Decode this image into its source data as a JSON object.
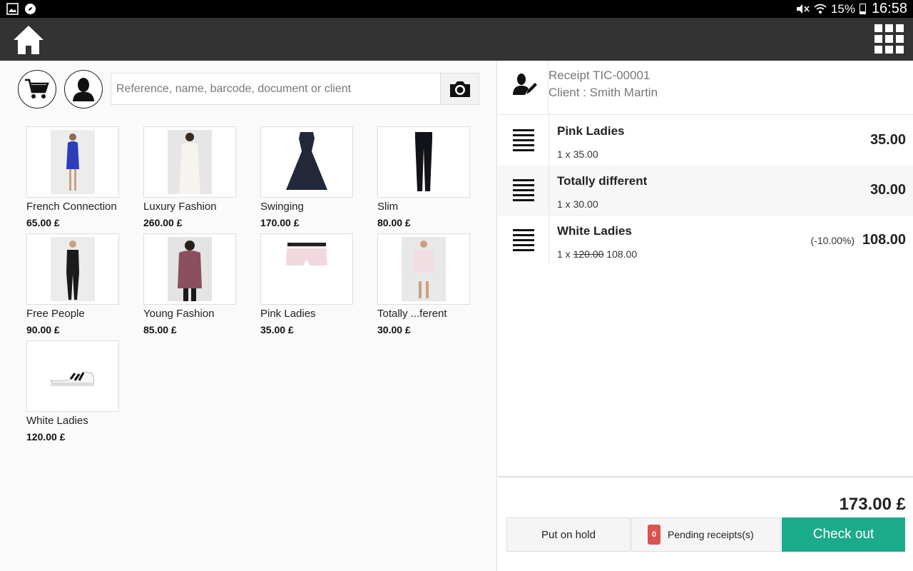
{
  "status_bar": {
    "battery": "15%",
    "time": "16:58",
    "icons": [
      "gallery-icon",
      "compass-icon",
      "mute-icon",
      "wifi-icon",
      "battery-icon"
    ]
  },
  "toolbar": {
    "home_icon": "home-icon",
    "menu_icon": "apps-grid-icon"
  },
  "search": {
    "placeholder": "Reference, name, barcode, document or client",
    "value": ""
  },
  "products": [
    {
      "name": "French Connection",
      "price": "65.00 £"
    },
    {
      "name": "Luxury Fashion",
      "price": "260.00 £"
    },
    {
      "name": "Swinging",
      "price": "170.00 £"
    },
    {
      "name": "Slim",
      "price": "80.00 £"
    },
    {
      "name": "Free People",
      "price": "90.00 £"
    },
    {
      "name": "Young Fashion",
      "price": "85.00 £"
    },
    {
      "name": "Pink Ladies",
      "price": "35.00 £"
    },
    {
      "name": "Totally ...ferent",
      "price": "30.00 £"
    },
    {
      "name": "White Ladies",
      "price": "120.00 £"
    }
  ],
  "receipt": {
    "title": "Receipt TIC-00001",
    "client": "Client : Smith Martin",
    "lines": [
      {
        "name": "Pink Ladies",
        "qty": "1 x 35.00",
        "total": "35.00"
      },
      {
        "name": "Totally different",
        "qty": "1 x 30.00",
        "total": "30.00"
      },
      {
        "name": "White Ladies",
        "qty_prefix": "1 x",
        "qty_original": "120.00",
        "qty_new": "108.00",
        "discount": "(-10.00%)",
        "total": "108.00"
      }
    ],
    "grand_total": "173.00 £"
  },
  "actions": {
    "hold": "Put on hold",
    "pending_count": "0",
    "pending": "Pending receipts(s)",
    "checkout": "Check out"
  },
  "colors": {
    "toolbar": "#333333",
    "checkout": "#1aab8a",
    "badge": "#d9534f"
  }
}
